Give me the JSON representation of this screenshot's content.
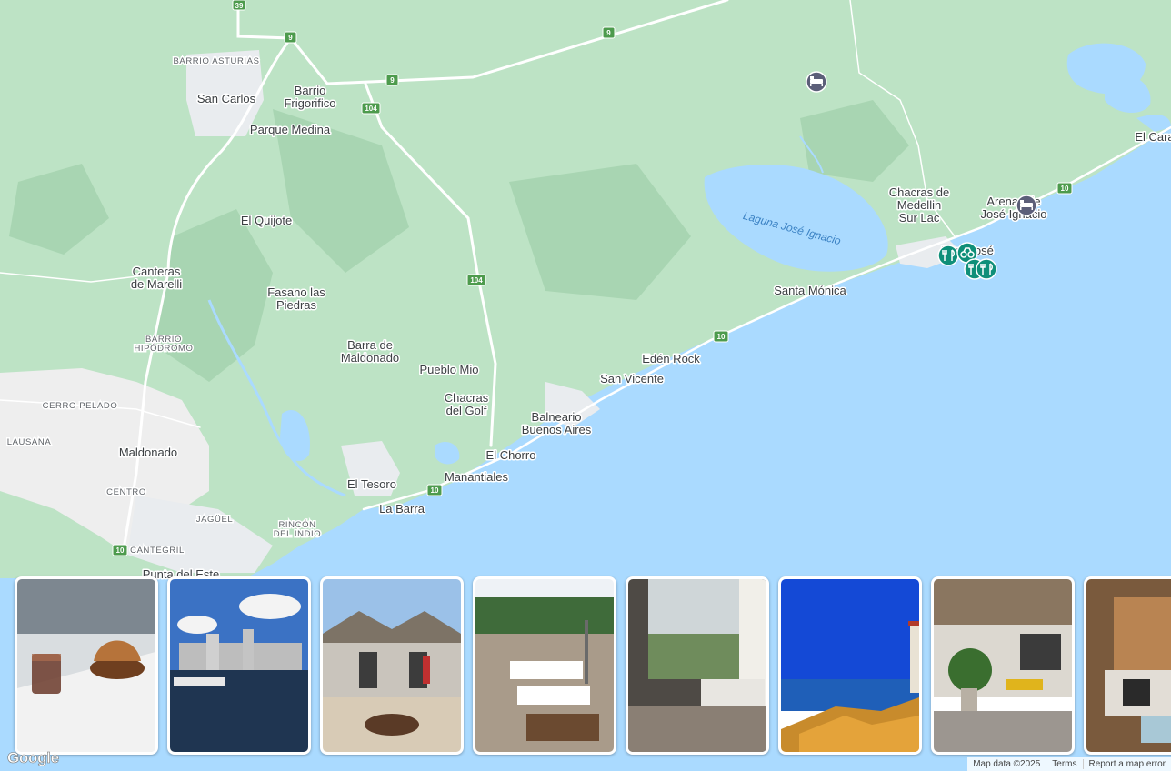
{
  "map": {
    "places": [
      {
        "id": "barrio-asturias",
        "text": "BARRIO ASTURIAS"
      },
      {
        "id": "san-carlos",
        "text": "San Carlos"
      },
      {
        "id": "barrio-frigorifico-1",
        "text": "Barrio"
      },
      {
        "id": "barrio-frigorifico-2",
        "text": "Frigorifico"
      },
      {
        "id": "parque-medina",
        "text": "Parque Medina"
      },
      {
        "id": "el-quijote",
        "text": "El Quijote"
      },
      {
        "id": "canteras-1",
        "text": "Canteras"
      },
      {
        "id": "canteras-2",
        "text": "de Marelli"
      },
      {
        "id": "fasano-1",
        "text": "Fasano las"
      },
      {
        "id": "fasano-2",
        "text": "Piedras"
      },
      {
        "id": "barrio-hipodromo-1",
        "text": "BARRIO"
      },
      {
        "id": "barrio-hipodromo-2",
        "text": "HIPÓDROMO"
      },
      {
        "id": "barra-maldonado-1",
        "text": "Barra de"
      },
      {
        "id": "barra-maldonado-2",
        "text": "Maldonado"
      },
      {
        "id": "pueblo-mio",
        "text": "Pueblo Mio"
      },
      {
        "id": "chacras-golf-1",
        "text": "Chacras"
      },
      {
        "id": "chacras-golf-2",
        "text": "del Golf"
      },
      {
        "id": "cerro-pelado",
        "text": "CERRO PELADO"
      },
      {
        "id": "lausana",
        "text": "LAUSANA"
      },
      {
        "id": "maldonado",
        "text": "Maldonado"
      },
      {
        "id": "centro",
        "text": "CENTRO"
      },
      {
        "id": "jaguel",
        "text": "JAGÜEL"
      },
      {
        "id": "rincon-1",
        "text": "RINCÓN"
      },
      {
        "id": "rincon-2",
        "text": "DEL INDIO"
      },
      {
        "id": "cantegril",
        "text": "CANTEGRIL"
      },
      {
        "id": "punta-del-este",
        "text": "Punta del Este"
      },
      {
        "id": "el-tesoro",
        "text": "El Tesoro"
      },
      {
        "id": "la-barra",
        "text": "La Barra"
      },
      {
        "id": "manantiales",
        "text": "Manantiales"
      },
      {
        "id": "el-chorro",
        "text": "El Chorro"
      },
      {
        "id": "balneario-1",
        "text": "Balneario"
      },
      {
        "id": "balneario-2",
        "text": "Buenos Aires"
      },
      {
        "id": "san-vicente",
        "text": "San Vicente"
      },
      {
        "id": "eden-rock",
        "text": "Edén Rock"
      },
      {
        "id": "santa-monica",
        "text": "Santa Mónica"
      },
      {
        "id": "chacras-medellin-1",
        "text": "Chacras de"
      },
      {
        "id": "chacras-medellin-2",
        "text": "Medellin"
      },
      {
        "id": "chacras-medellin-3",
        "text": "Sur Lac"
      },
      {
        "id": "arenas-1",
        "text": "Arenas de"
      },
      {
        "id": "arenas-2",
        "text": "José Ignacio"
      },
      {
        "id": "faro-jose",
        "text": "Faro José"
      },
      {
        "id": "el-caracol",
        "text": "El Cara"
      }
    ],
    "water": [
      {
        "id": "laguna-jose-ignacio",
        "text": "Laguna José Ignacio"
      }
    ],
    "routes": [
      "39",
      "9",
      "9",
      "9",
      "104",
      "104",
      "10",
      "10",
      "10",
      "10"
    ],
    "colors": {
      "land": "#bde3c5",
      "forest": "#a8d5b2",
      "water": "#aadaff",
      "road": "#ffffff",
      "urban": "#eeeeee",
      "route_shield": "#4d9b4d",
      "hotel_pin": "#5c5f79",
      "food_pin": "#0f8f79"
    },
    "pins": [
      {
        "type": "hotel",
        "icon": "bed-icon"
      },
      {
        "type": "hotel",
        "icon": "bed-icon"
      },
      {
        "type": "restaurant",
        "icon": "fork-knife-icon"
      },
      {
        "type": "attraction",
        "icon": "binoculars-icon"
      },
      {
        "type": "restaurant",
        "icon": "fork-knife-icon"
      },
      {
        "type": "restaurant",
        "icon": "fork-knife-icon"
      }
    ]
  },
  "photos": [
    {
      "subject": "Coffee glass and croissant on a table"
    },
    {
      "subject": "Marina with boats and city skyline"
    },
    {
      "subject": "Thatched patio with fire pit"
    },
    {
      "subject": "Outdoor restaurant terrace with tables"
    },
    {
      "subject": "Hotel room with sea view window"
    },
    {
      "subject": "Lighthouse above rocky coast"
    },
    {
      "subject": "Pergola terrace with yellow chairs"
    },
    {
      "subject": "Rustic living room with fireplace"
    }
  ],
  "attribution": {
    "logo": "Google",
    "map_data": "Map data ©2025",
    "terms": "Terms",
    "report": "Report a map error"
  }
}
